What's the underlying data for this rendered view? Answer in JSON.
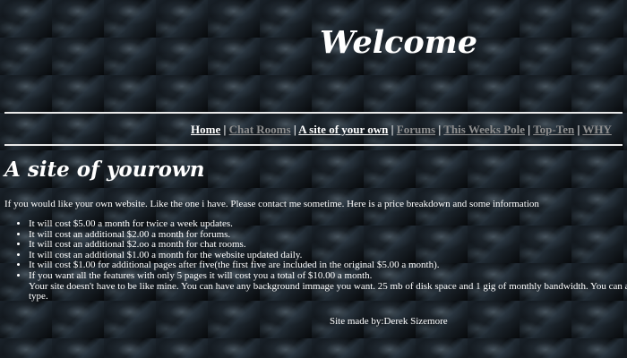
{
  "page": {
    "welcome": "Welcome"
  },
  "nav": {
    "items": [
      {
        "label": "Home",
        "style": "light"
      },
      {
        "label": "Chat Rooms",
        "style": "dim"
      },
      {
        "label": "A site of your own",
        "style": "light"
      },
      {
        "label": "Forums",
        "style": "dim"
      },
      {
        "label": "This Weeks Pole",
        "style": "dim"
      },
      {
        "label": "Top-Ten",
        "style": "dim"
      },
      {
        "label": "WHY",
        "style": "dim"
      }
    ],
    "separator": "|"
  },
  "section": {
    "title": "A site of yourown",
    "intro": "If you would like your own website. Like the one i have. Please contact me sometime. Here is a price breakdown and some information"
  },
  "prices": [
    "It will cost $5.00 a month for twice a week updates.",
    "It will cost an additional $2.00 a month for forums.",
    "It will cost an additional $2.oo a month for chat rooms.",
    "It will cost an additional $1.00 a month for the website updated daily.",
    "It will cost $1.00 for additional pages after five(the first five are included in the original $5.00 a month).",
    "If you want all the features with only 5 pages it will cost you a total of $10.00 a month."
  ],
  "extra_text": [
    "Your site doesn't have to be like mine. You can have any background immage you want. 25 mb of disk space and 1 gig of monthly bandwidth. You can als",
    "type."
  ],
  "footer": {
    "credit": "Site made by:Derek Sizemore"
  },
  "colors": {
    "line": "#e8e8e8",
    "link_active": "#ffffff",
    "link_inactive": "#8f8f8f"
  }
}
